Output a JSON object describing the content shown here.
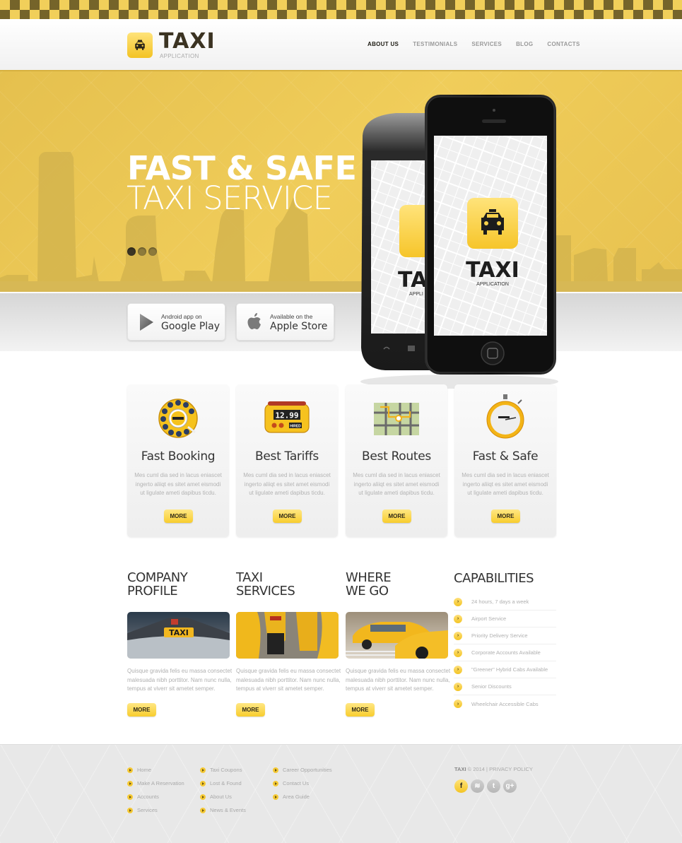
{
  "header": {
    "logo_title": "TAXI",
    "logo_subtitle": "APPLICATION",
    "nav": [
      {
        "label": "ABOUT US",
        "active": true
      },
      {
        "label": "TESTIMONIALS",
        "active": false
      },
      {
        "label": "SERVICES",
        "active": false
      },
      {
        "label": "BLOG",
        "active": false
      },
      {
        "label": "CONTACTS",
        "active": false
      }
    ]
  },
  "hero": {
    "title_line1": "FAST & SAFE",
    "title_line2": "TAXI SERVICE",
    "slider_count": 3,
    "slider_active": 1,
    "phone_app_title": "TAXI",
    "phone_app_subtitle": "APPLICATION",
    "store_buttons": [
      {
        "small": "Android app on",
        "big": "Google Play",
        "icon": "google-play-icon"
      },
      {
        "small": "Available on the",
        "big": "Apple Store",
        "icon": "apple-icon"
      }
    ]
  },
  "features": [
    {
      "title": "Fast Booking",
      "icon": "rotary-phone-icon",
      "text": "Mes cuml dia sed in lacus eniascet ingerto aliiqt es sitet amet eismodi ut ligulate ameti dapibus ticdu.",
      "button": "MORE"
    },
    {
      "title": "Best Tariffs",
      "icon": "taximeter-icon",
      "text": "Mes cuml dia sed in lacus eniascet ingerto aliiqt es sitet amet eismodi ut ligulate ameti dapibus ticdu.",
      "button": "MORE",
      "meter": "12.99",
      "meter_label": "HIRED"
    },
    {
      "title": "Best Routes",
      "icon": "route-map-icon",
      "text": "Mes cuml dia sed in lacus eniascet ingerto aliiqt es sitet amet eismodi ut ligulate ameti dapibus ticdu.",
      "button": "MORE"
    },
    {
      "title": "Fast & Safe",
      "icon": "stopwatch-icon",
      "text": "Mes cuml dia sed in lacus eniascet ingerto aliiqt es sitet amet eismodi ut ligulate ameti dapibus ticdu.",
      "button": "MORE"
    }
  ],
  "columns": [
    {
      "title": "COMPANY\nPROFILE",
      "image": "taxi-roof-sign-photo",
      "text": "Quisque gravida felis eu massa consectet malesuada nibh porttitor. Nam nunc nulla, tempus at viverr sit ametet semper.",
      "button": "MORE"
    },
    {
      "title": "TAXI\nSERVICES",
      "image": "taxi-row-photo",
      "text": "Quisque gravida felis eu massa consectet malesuada nibh porttitor. Nam nunc nulla, tempus at viverr sit ametet semper.",
      "button": "MORE"
    },
    {
      "title": "WHERE\nWE GO",
      "image": "city-taxis-photo",
      "text": "Quisque gravida felis eu massa consectet malesuada nibh porttitor. Nam nunc nulla, tempus at viverr sit ametet semper.",
      "button": "MORE"
    }
  ],
  "capabilities": {
    "title": "CAPABILITIES",
    "items": [
      "24 hours, 7 days a week",
      "Airport Service",
      "Priority Delivery Service",
      "Corporate Accounts Available",
      "\"Greener\" Hybrid Cabs Available",
      "Senior Discounts",
      "Wheelchair Accessible Cabs"
    ]
  },
  "footer": {
    "links_col1": [
      "Home",
      "Make A Reservation",
      "Accounts",
      "Services"
    ],
    "links_col2": [
      "Taxi Coupons",
      "Lost & Found",
      "About Us",
      "News & Events"
    ],
    "links_col3": [
      "Career Opportunities",
      "Contact Us",
      "Area Guide"
    ],
    "brand": "TAXI",
    "copyright": "© 2014",
    "separator": "|",
    "privacy": "PRIVACY POLICY",
    "social": [
      {
        "name": "facebook",
        "glyph": "f"
      },
      {
        "name": "rss",
        "glyph": "≋"
      },
      {
        "name": "twitter",
        "glyph": "t"
      },
      {
        "name": "google-plus",
        "glyph": "g+"
      }
    ]
  },
  "colors": {
    "accent_yellow": "#f8cd2e",
    "hero_yellow": "#f0cd5a",
    "checker_dark": "#75642a",
    "text_dark": "#333333",
    "text_muted": "#b0b0b0"
  }
}
